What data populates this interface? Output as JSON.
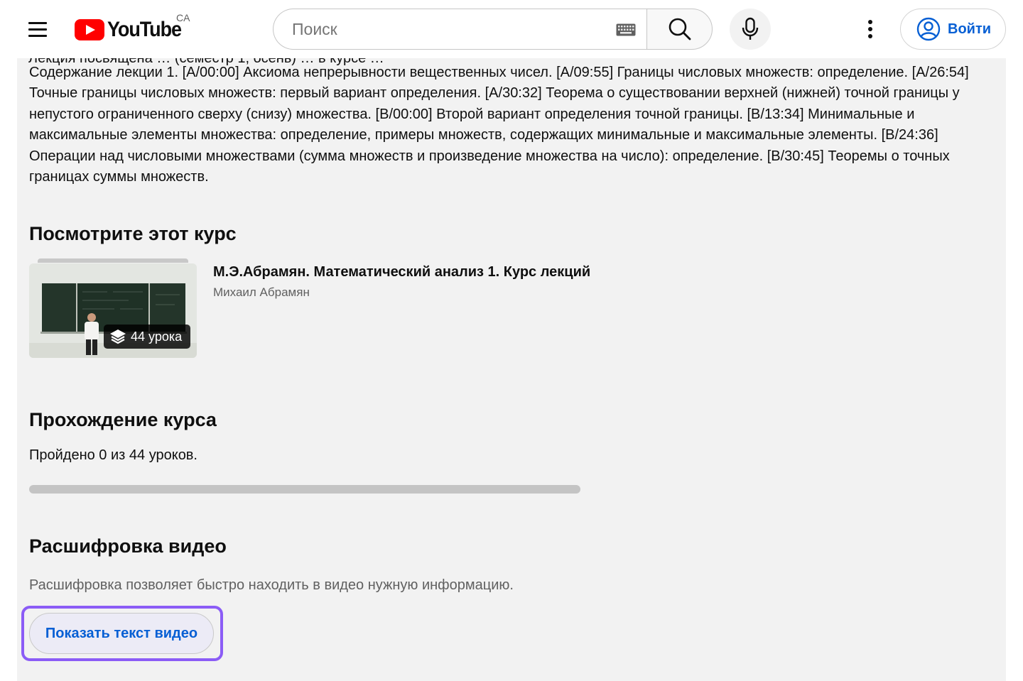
{
  "header": {
    "logo_text": "YouTube",
    "region_code": "CA",
    "search_placeholder": "Поиск",
    "signin_label": "Войти"
  },
  "description": {
    "clipped_line": "Лекция посвящена … (семестр 1, осень) … в курсе … ",
    "text": "Содержание лекции 1. [A/00:00] Аксиома непрерывности вещественных чисел. [A/09:55] Границы числовых множеств: определение. [A/26:54] Точные границы числовых множеств: первый вариант определения. [A/30:32] Теорема о существовании верхней (нижней) точной границы у непустого ограниченного сверху (снизу) множества. [B/00:00] Второй вариант определения точной границы. [B/13:34] Минимальные и максимальные элементы множества: определение, примеры множеств, содержащих минимальные и максимальные элементы. [B/24:36] Операции над числовыми множествами (сумма множеств и произведение множества на число): определение. [B/30:45] Теоремы о точных границах суммы множеств."
  },
  "course": {
    "section_title": "Посмотрите этот курс",
    "title": "М.Э.Абрамян. Математический анализ 1. Курс лекций",
    "author": "Михаил Абрамян",
    "lessons_badge": "44 урока"
  },
  "progress": {
    "section_title": "Прохождение курса",
    "text": "Пройдено 0 из 44 уроков.",
    "completed": 0,
    "total": 44
  },
  "transcript": {
    "section_title": "Расшифровка видео",
    "description": "Расшифровка позволяет быстро находить в видео нужную информацию.",
    "button_label": "Показать текст видео"
  },
  "colors": {
    "accent": "#065fd4",
    "focus_ring": "#8b5cf6",
    "panel_bg": "#f2f2f2",
    "brand_red": "#ff0000"
  },
  "icons": {
    "menu": "hamburger-menu-icon",
    "search": "search-icon",
    "keyboard": "keyboard-icon",
    "mic": "microphone-icon",
    "more": "more-vertical-icon",
    "account": "account-circle-icon",
    "playlist": "playlist-stack-icon"
  }
}
